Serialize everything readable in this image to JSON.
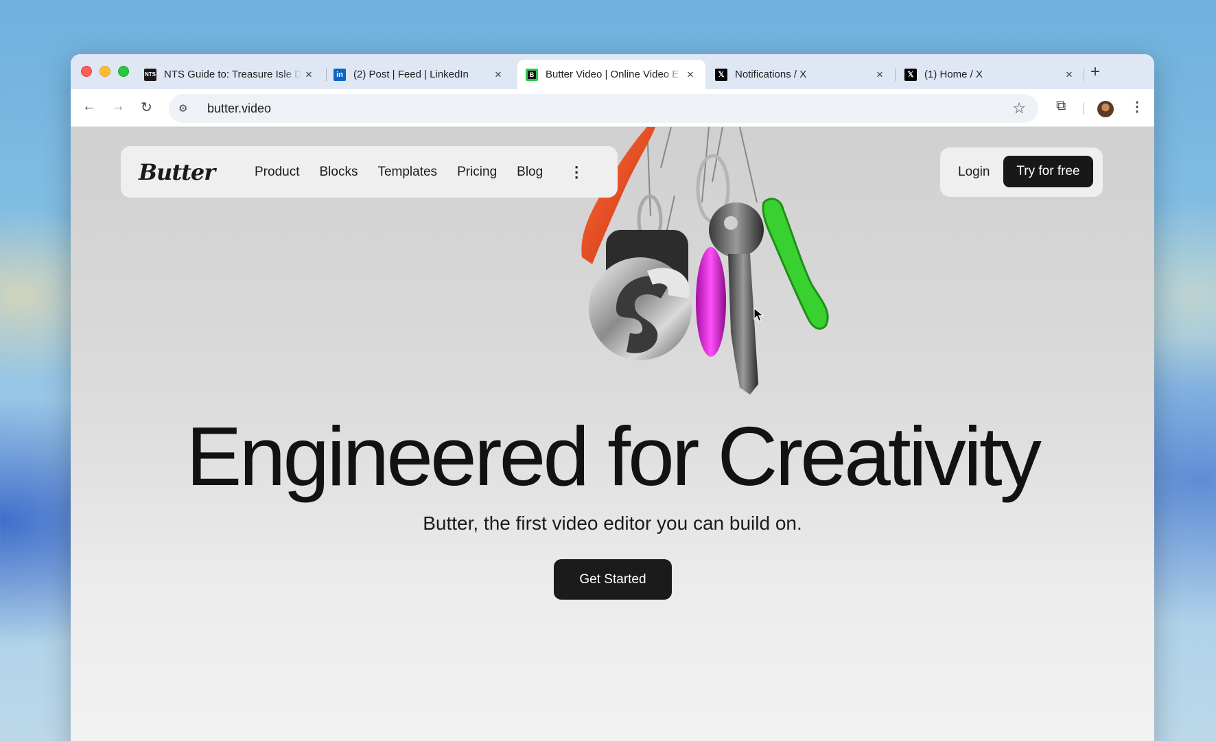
{
  "browser": {
    "tabs": [
      {
        "favicon": "nts-favicon",
        "title": "NTS Guide to: Treasure Isle D",
        "close": "×"
      },
      {
        "favicon": "linkedin-favicon",
        "title": "(2) Post | Feed | LinkedIn",
        "close": "×"
      },
      {
        "favicon": "butter-favicon",
        "title": "Butter Video | Online Video E",
        "close": "×",
        "active": true
      },
      {
        "favicon": "x-favicon",
        "title": "Notifications / X",
        "close": "×"
      },
      {
        "favicon": "x-favicon",
        "title": "(1) Home / X",
        "close": "×"
      }
    ],
    "favicon_glyphs": {
      "nts": "NTS",
      "linkedin": "in",
      "butter": "B",
      "x": "𝕏"
    },
    "new_tab": "+",
    "url": "butter.video",
    "icons": {
      "back": "←",
      "forward": "→",
      "reload": "↻",
      "site_info": "⚙",
      "bookmark": "☆",
      "extensions": "⧉",
      "menu": "⋮"
    }
  },
  "site": {
    "logo": "Butter",
    "nav": [
      "Product",
      "Blocks",
      "Templates",
      "Pricing",
      "Blog"
    ],
    "more": "⋮",
    "login": "Login",
    "try_free": "Try for free",
    "headline": "Engineered for Creativity",
    "subheadline": "Butter, the first video editor you can build on.",
    "cta": "Get Started"
  },
  "colors": {
    "linkedin_blue": "#0a66c2",
    "butter_green": "#2fc94a",
    "keychain_orange": "#e8491f",
    "keychain_magenta": "#d41bd1",
    "keychain_green": "#39d12f",
    "button_dark": "#181818"
  }
}
